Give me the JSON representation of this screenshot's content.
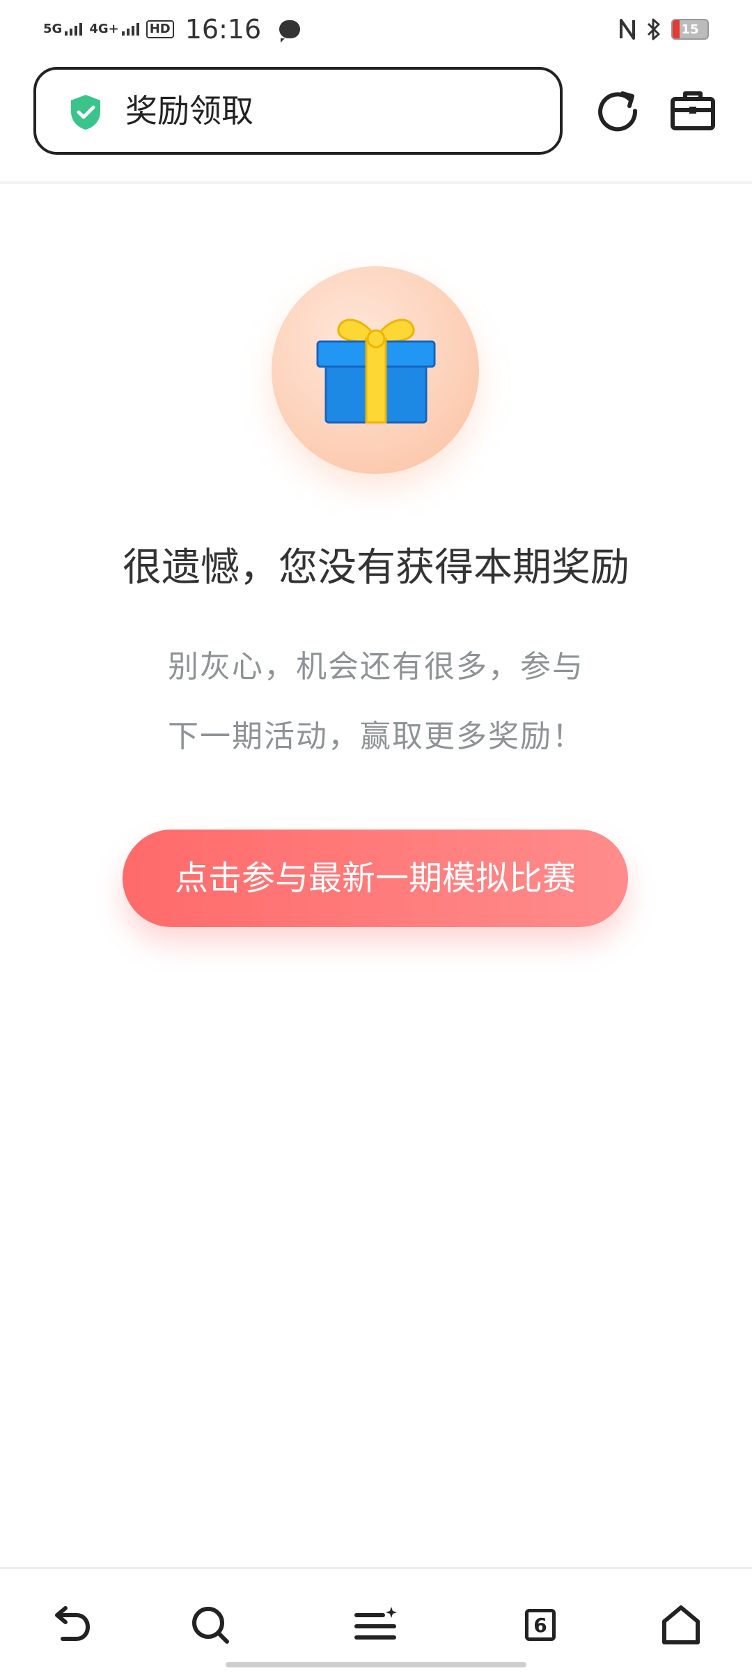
{
  "status_bar": {
    "network1": "5G",
    "network2": "4G+",
    "hd": "HD",
    "time": "16:16",
    "battery": "15"
  },
  "address_bar": {
    "text": "奖励领取"
  },
  "main": {
    "headline": "很遗憾，您没有获得本期奖励",
    "subtext_line1": "别灰心，机会还有很多，参与",
    "subtext_line2": "下一期活动，赢取更多奖励！",
    "cta_label": "点击参与最新一期模拟比赛"
  },
  "bottom_nav": {
    "tab_count": "6"
  },
  "colors": {
    "accent": "#ff7272",
    "shield": "#3ac48c",
    "gift_box": "#1e88e5",
    "gift_ribbon": "#fdd835"
  }
}
